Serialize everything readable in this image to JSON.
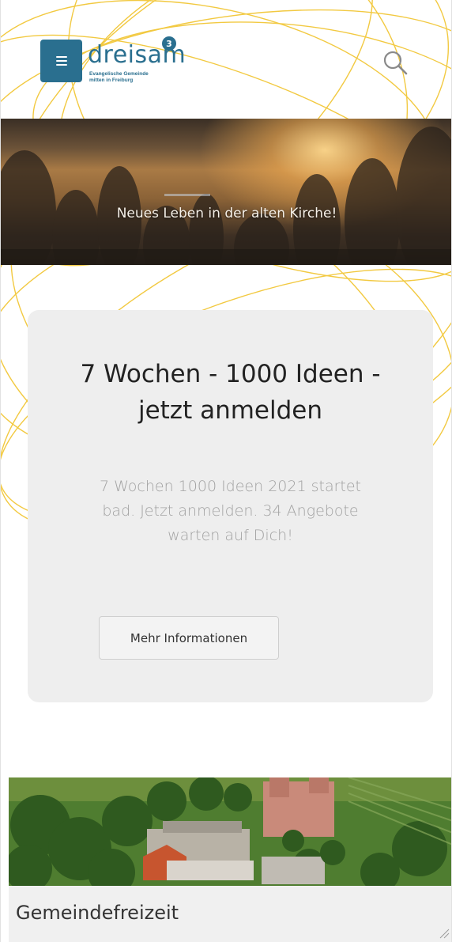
{
  "header": {
    "menu_icon": "hamburger-icon",
    "logo": {
      "word": "dreisam",
      "badge": "3",
      "tagline_line1": "Evangelische Gemeinde",
      "tagline_line2": "mitten in Freiburg"
    },
    "search_icon": "search-icon",
    "brand_color": "#2a6f8f"
  },
  "hero": {
    "caption": "Neues Leben in der alten Kirche!"
  },
  "card": {
    "title": "7 Wochen - 1000 Ideen - jetzt anmelden",
    "text": "7 Wochen 1000 Ideen 2021 startet bad. Jetzt anmelden. 34 Angebote warten auf Dich!",
    "button_label": "Mehr Informationen"
  },
  "teaser": {
    "title": "Gemeindefreizeit"
  },
  "colors": {
    "accent_lines": "#f0c020",
    "card_background": "#eeeeee"
  }
}
